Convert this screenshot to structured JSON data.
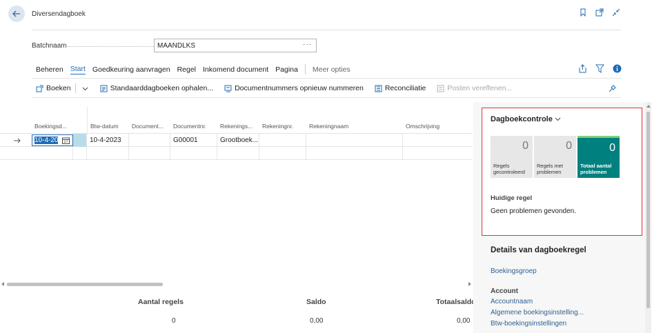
{
  "header": {
    "title": "Diversendagboek"
  },
  "batch": {
    "label": "Batchnaam",
    "value": "MAANDLKS",
    "lookup": "···"
  },
  "menu": {
    "items": [
      "Beheren",
      "Start",
      "Goedkeuring aanvragen",
      "Regel",
      "Inkomend document",
      "Pagina"
    ],
    "active": "Start",
    "more": "Meer opties"
  },
  "toolbar": {
    "boeken": "Boeken",
    "standaard": "Standaarddagboeken ophalen...",
    "docnummers": "Documentnummers opnieuw nummeren",
    "reconciliatie": "Reconciliatie",
    "posten": "Posten vereffenen..."
  },
  "grid": {
    "columns": [
      "Boekingsd...",
      "Btw-datum",
      "Document...",
      "Documentnr.",
      "Rekenings...",
      "Rekeningnr.",
      "Rekeningnaam",
      "Omschrijving"
    ],
    "row1": {
      "boekingsdatum": "10-4-20",
      "btw_datum": "10-4-2023",
      "documentnr": "G00001",
      "rekeningsoort": "Grootboek..."
    }
  },
  "totals": {
    "aantal_regels_label": "Aantal regels",
    "aantal_regels_value": "0",
    "saldo_label": "Saldo",
    "saldo_value": "0,00",
    "totaalsaldo_label": "Totaalsaldo",
    "totaalsaldo_value": "0,00"
  },
  "factbox": {
    "title": "Dagboekcontrole",
    "tiles": [
      {
        "value": "0",
        "label": "Regels gecontroleerd"
      },
      {
        "value": "0",
        "label": "Regels met problemen"
      },
      {
        "value": "0",
        "label": "Totaal aantal problemen"
      }
    ],
    "current_line_label": "Huidige regel",
    "current_line_text": "Geen problemen gevonden."
  },
  "details": {
    "title": "Details van dagboekregel",
    "boekingsgroep": "Boekingsgroep",
    "account_label": "Account",
    "links": [
      "Accountnaam",
      "Algemene boekingsinstelling...",
      "Btw-boekingsinstellingen"
    ]
  },
  "colors": {
    "accent": "#1f6bb5",
    "highlight_border": "#e03030",
    "tile_alert": "#00807f"
  }
}
